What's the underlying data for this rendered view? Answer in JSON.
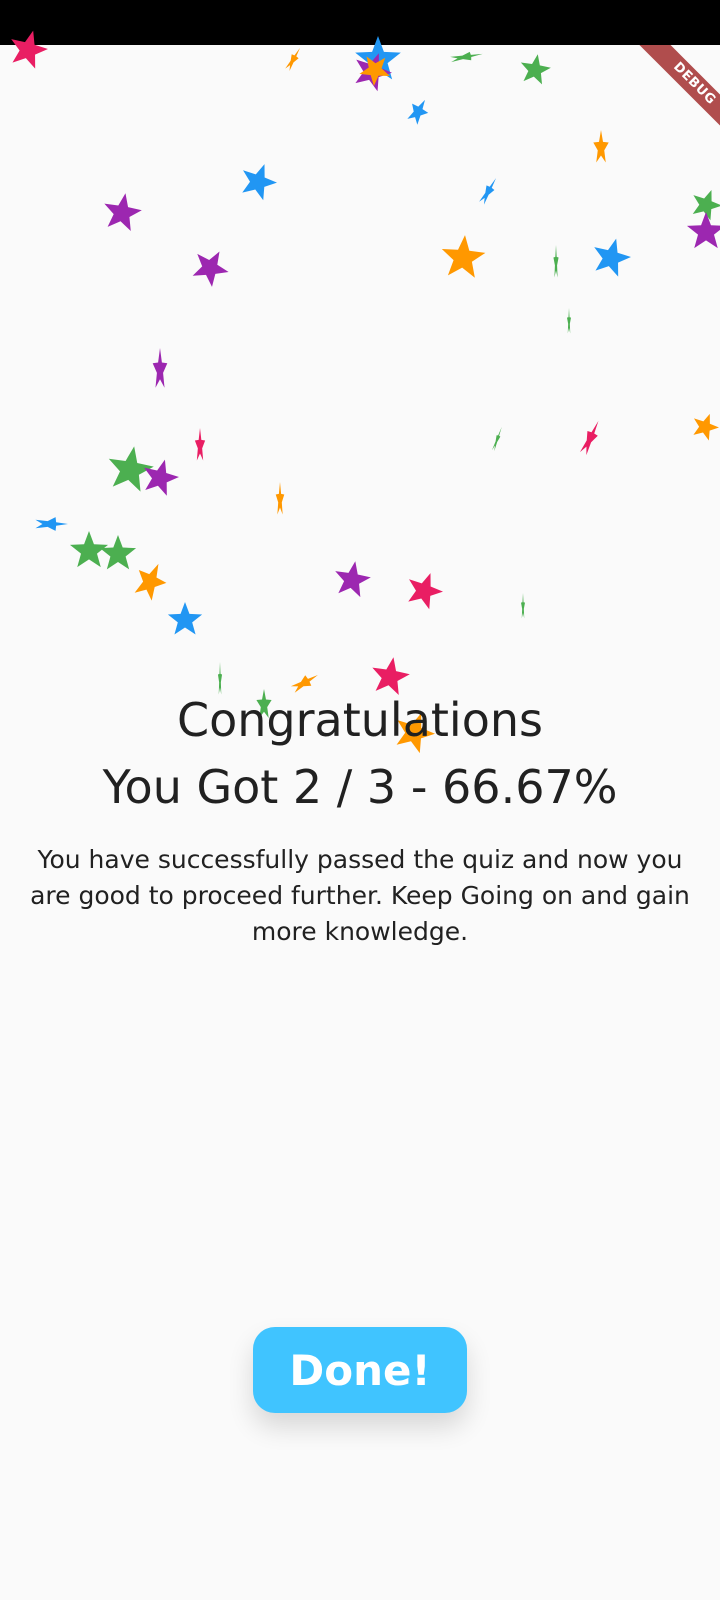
{
  "debug_banner": {
    "label": "DEBUG",
    "color": "#b04d4d"
  },
  "result": {
    "title": "Congratulations",
    "score_text": "You Got 2 / 3 - 66.67%",
    "correct": 2,
    "total": 3,
    "percent": 66.67,
    "message": "You have successfully passed the quiz and now you are good to proceed further. Keep Going on and gain more knowledge."
  },
  "done_button": {
    "label": "Done!",
    "color": "#40c4ff"
  },
  "confetti": {
    "icon": "star-confetti",
    "colors": {
      "pink": "#e91e63",
      "purple": "#9c27b0",
      "blue": "#2196f3",
      "green": "#4caf50",
      "orange": "#ff9800"
    }
  },
  "colors": {
    "background": "#fafafa",
    "text": "#212121",
    "status_bar": "#000000"
  }
}
